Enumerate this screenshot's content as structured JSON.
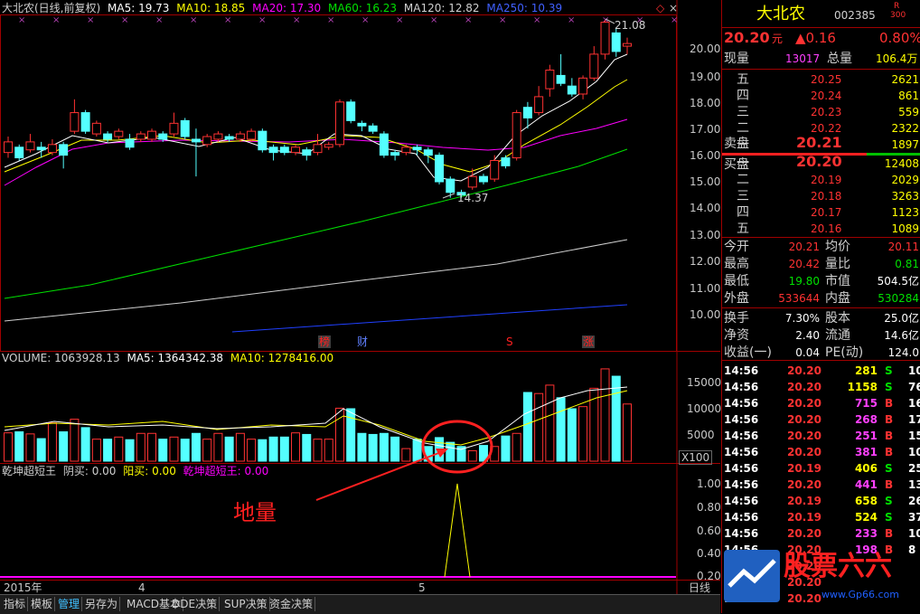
{
  "main": {
    "indicator_line": {
      "title": "大北农(日线,前复权)",
      "ma5": "MA5: 19.73",
      "ma10": "MA10: 18.85",
      "ma20": "MA20: 17.30",
      "ma60": "MA60: 16.23",
      "ma120": "MA120: 12.82",
      "ma250": "MA250: 10.39"
    },
    "price_axis": [
      "20.00",
      "19.00",
      "18.00",
      "17.00",
      "16.00",
      "15.00",
      "14.00",
      "13.00",
      "12.00",
      "11.00",
      "10.00"
    ],
    "high_mark": "21.08",
    "low_mark": "14.37",
    "events": [
      "榜",
      "财",
      "S",
      "涨"
    ],
    "volume_line": {
      "title": "VOLUME: 1063928.13",
      "ma5": "MA5: 1364342.38",
      "ma10": "MA10: 1278416.00"
    },
    "volume_axis": [
      "15000",
      "10000",
      "5000"
    ],
    "volume_unit": "X100",
    "indicator2": {
      "title": "乾坤超短王",
      "yinmai": "阴买: 0.00",
      "yangmai": "阳买: 0.00",
      "value": "乾坤超短王: 0.00"
    },
    "ind2_axis": [
      "1.00",
      "0.80",
      "0.60",
      "0.40",
      "0.20"
    ],
    "annotation": "地量",
    "date_labels": [
      "2015年",
      "4",
      "5"
    ],
    "period_label": "日线",
    "tabs": [
      "指标",
      "模板",
      "管理",
      "另存为",
      "MACD基本",
      "DDE决策",
      "SUP决策",
      "资金决策"
    ],
    "colors": {
      "up": "#ff3232",
      "down": "#54ffff",
      "ma5": "#ffffff",
      "ma10": "#ffff00",
      "ma20": "#ff00ff",
      "ma60": "#00e000",
      "ma120": "#d0d0d0",
      "ma250": "#2040ff"
    }
  },
  "quote": {
    "name": "大北农",
    "code": "002385",
    "badge_r": "R",
    "badge_num": "300",
    "price": "20.20",
    "price_unit": "元",
    "change": "▲0.16",
    "change_pct": "0.80%",
    "now_vol_label": "现量",
    "now_vol": "13017",
    "total_vol_label": "总量",
    "total_vol": "106.4万",
    "asks": [
      {
        "level": "五",
        "price": "20.25",
        "vol": "2621"
      },
      {
        "level": "四",
        "price": "20.24",
        "vol": "861"
      },
      {
        "level": "三",
        "price": "20.23",
        "vol": "559"
      },
      {
        "level": "二",
        "price": "20.22",
        "vol": "2322"
      },
      {
        "level": "一",
        "price": "20.21",
        "vol": "1897"
      }
    ],
    "ask_label": "卖盘",
    "bid_label": "买盘",
    "bids": [
      {
        "level": "一",
        "price": "20.20",
        "vol": "12408"
      },
      {
        "level": "二",
        "price": "20.19",
        "vol": "2029"
      },
      {
        "level": "三",
        "price": "20.18",
        "vol": "3263"
      },
      {
        "level": "四",
        "price": "20.17",
        "vol": "1123"
      },
      {
        "level": "五",
        "price": "20.16",
        "vol": "1089"
      }
    ],
    "stats": [
      {
        "k1": "今开",
        "v1": "20.21",
        "k2": "均价",
        "v2": "20.11"
      },
      {
        "k1": "最高",
        "v1": "20.42",
        "k2": "量比",
        "v2": "0.81"
      },
      {
        "k1": "最低",
        "v1": "19.80",
        "k2": "市值",
        "v2": "504.5亿"
      },
      {
        "k1": "外盘",
        "v1": "533644",
        "k2": "内盘",
        "v2": "530284"
      }
    ],
    "stats2": [
      {
        "k1": "换手",
        "v1": "7.30%",
        "k2": "股本",
        "v2": "25.0亿"
      },
      {
        "k1": "净资",
        "v1": "2.40",
        "k2": "流通",
        "v2": "14.6亿"
      },
      {
        "k1": "收益(一)",
        "v1": "0.04",
        "k2": "PE(动)",
        "v2": "124.0"
      }
    ],
    "ticks": [
      {
        "t": "14:56",
        "p": "20.20",
        "v": "281",
        "d": "S",
        "n": "10"
      },
      {
        "t": "14:56",
        "p": "20.20",
        "v": "1158",
        "d": "S",
        "n": "76"
      },
      {
        "t": "14:56",
        "p": "20.20",
        "v": "715",
        "d": "B",
        "n": "16"
      },
      {
        "t": "14:56",
        "p": "20.20",
        "v": "268",
        "d": "B",
        "n": "17"
      },
      {
        "t": "14:56",
        "p": "20.20",
        "v": "251",
        "d": "B",
        "n": "15"
      },
      {
        "t": "14:56",
        "p": "20.20",
        "v": "381",
        "d": "B",
        "n": "10"
      },
      {
        "t": "14:56",
        "p": "20.19",
        "v": "406",
        "d": "S",
        "n": "25"
      },
      {
        "t": "14:56",
        "p": "20.20",
        "v": "441",
        "d": "B",
        "n": "13"
      },
      {
        "t": "14:56",
        "p": "20.19",
        "v": "658",
        "d": "S",
        "n": "26"
      },
      {
        "t": "14:56",
        "p": "20.19",
        "v": "524",
        "d": "S",
        "n": "37"
      },
      {
        "t": "14:56",
        "p": "20.20",
        "v": "233",
        "d": "B",
        "n": "10"
      },
      {
        "t": "14:56",
        "p": "20.20",
        "v": "198",
        "d": "B",
        "n": "8"
      },
      {
        "t": "14:57",
        "p": "20.20",
        "v": "",
        "d": "",
        "n": ""
      },
      {
        "t": "14:57",
        "p": "20.20",
        "v": "",
        "d": "",
        "n": ""
      },
      {
        "t": "15:00",
        "p": "20.20",
        "v": "",
        "d": "",
        "n": ""
      }
    ],
    "watermark": "股票六六",
    "watermark_url": "www.Gp66.com"
  }
}
